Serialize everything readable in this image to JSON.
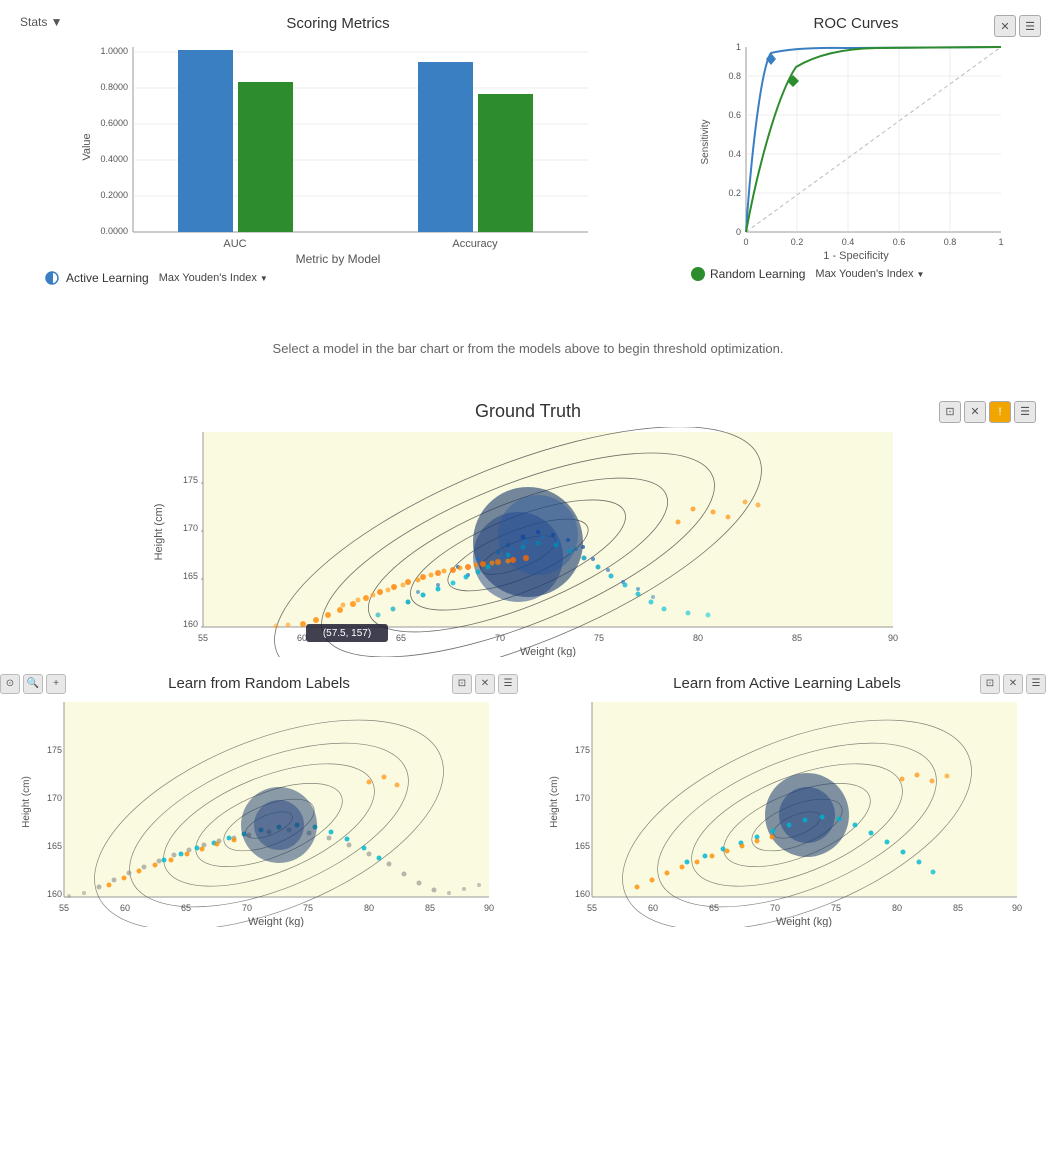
{
  "header": {
    "stats_button": "Stats ▼"
  },
  "scoring_metrics": {
    "title": "Scoring Metrics",
    "x_label": "Metric by Model",
    "y_label": "Value",
    "bars": [
      {
        "metric": "AUC",
        "model": "active",
        "value": 0.975,
        "color": "#3a7fc1"
      },
      {
        "metric": "AUC",
        "model": "random",
        "value": 0.87,
        "color": "#2d8c2d"
      },
      {
        "metric": "Accuracy",
        "model": "active",
        "value": 0.93,
        "color": "#3a7fc1"
      },
      {
        "metric": "Accuracy",
        "model": "random",
        "value": 0.8,
        "color": "#2d8c2d"
      }
    ],
    "y_ticks": [
      "0.0000",
      "0.2000",
      "0.4000",
      "0.6000",
      "0.8000",
      "1.0000"
    ],
    "x_ticks": [
      "AUC",
      "Accuracy"
    ]
  },
  "roc_curves": {
    "title": "ROC Curves",
    "x_label": "1 - Specificity",
    "y_label": "Sensitivity",
    "x_ticks": [
      "0",
      "0.2",
      "0.4",
      "0.6",
      "0.8",
      "1"
    ],
    "y_ticks": [
      "0",
      "0.2",
      "0.4",
      "0.6",
      "0.8",
      "1"
    ]
  },
  "legend": {
    "active_learning": {
      "label": "Active Learning",
      "color": "#3a7fc1",
      "dropdown": "Max Youden's Index ▼"
    },
    "random_learning": {
      "label": "Random Learning",
      "color": "#2d8c2d",
      "dropdown": "Max Youden's Index ▼"
    }
  },
  "threshold_msg": "Select a model in the bar chart or from the models above to begin threshold optimization.",
  "ground_truth": {
    "title": "Ground Truth",
    "tooltip": "(57.5, 157)",
    "x_label": "Weight (kg)",
    "y_label": "Height (cm)",
    "x_ticks": [
      "55",
      "60",
      "65",
      "70",
      "75",
      "80",
      "85",
      "90"
    ],
    "y_ticks": [
      "160",
      "165",
      "170",
      "175"
    ],
    "icons": [
      "resize",
      "close",
      "warning",
      "menu"
    ]
  },
  "learn_random": {
    "title": "Learn from Random Labels",
    "x_label": "Weight (kg)",
    "y_label": "Height (cm)",
    "x_ticks": [
      "55",
      "60",
      "65",
      "70",
      "75",
      "80",
      "85",
      "90"
    ],
    "y_ticks": [
      "160",
      "165",
      "170",
      "175"
    ],
    "icons": [
      "resize",
      "close",
      "menu"
    ]
  },
  "learn_active": {
    "title": "Learn from Active Learning Labels",
    "x_label": "Weight (kg)",
    "y_label": "Height (cm)",
    "x_ticks": [
      "55",
      "60",
      "65",
      "70",
      "75",
      "80",
      "85",
      "90"
    ],
    "y_ticks": [
      "160",
      "165",
      "170",
      "175"
    ],
    "icons": [
      "resize",
      "close",
      "menu"
    ]
  }
}
